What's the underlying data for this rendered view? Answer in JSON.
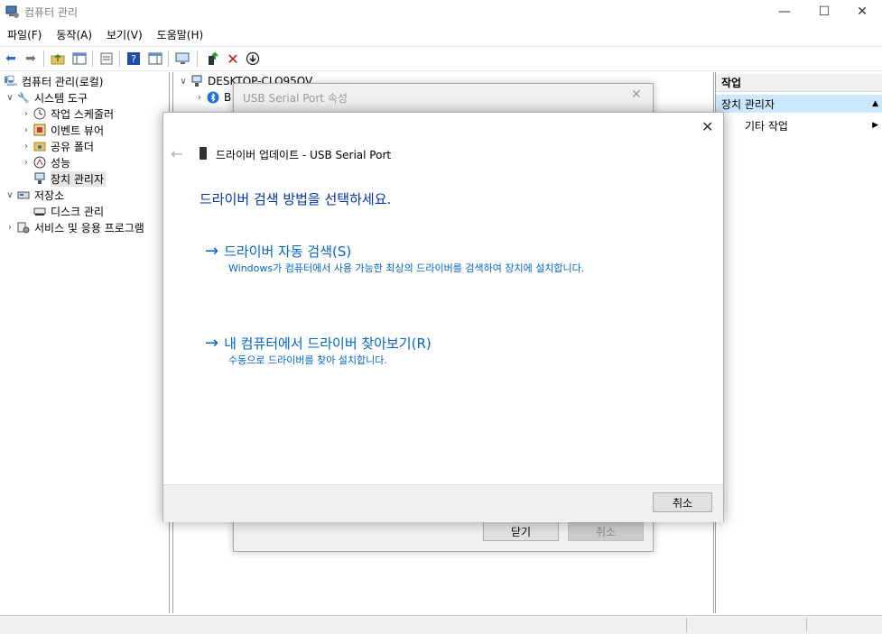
{
  "window": {
    "title": "컴퓨터 관리",
    "minimize": "—",
    "maximize": "☐",
    "close": "✕"
  },
  "menu": [
    "파일(F)",
    "동작(A)",
    "보기(V)",
    "도움말(H)"
  ],
  "tree": {
    "root": "컴퓨터 관리(로컬)",
    "system_tools": "시스템 도구",
    "task_scheduler": "작업 스케줄러",
    "event_viewer": "이벤트 뷰어",
    "shared_folders": "공유 폴더",
    "performance": "성능",
    "device_manager": "장치 관리자",
    "storage": "저장소",
    "disk_management": "디스크 관리",
    "services_apps": "서비스 및 응용 프로그램"
  },
  "middle": {
    "computer_node": "DESKTOP-CLO95OV",
    "child_partial": "B"
  },
  "actions": {
    "header": "작업",
    "device_manager": "장치 관리자",
    "more_actions": "기타 작업"
  },
  "properties_dialog": {
    "title": "USB Serial Port 속성",
    "close_button": "닫기",
    "cancel_button": "취소"
  },
  "wizard": {
    "title": "드라이버 업데이트 - USB Serial Port",
    "heading": "드라이버 검색 방법을 선택하세요.",
    "option_auto": {
      "title": "드라이버 자동 검색(S)",
      "description": "Windows가 컴퓨터에서 사용 가능한 최상의 드라이버를 검색하여 장치에 설치합니다."
    },
    "option_browse": {
      "title": "내 컴퓨터에서 드라이버 찾아보기(R)",
      "description": "수동으로 드라이버를 찾아 설치합니다."
    },
    "cancel_button": "취소",
    "arrow": "→"
  }
}
